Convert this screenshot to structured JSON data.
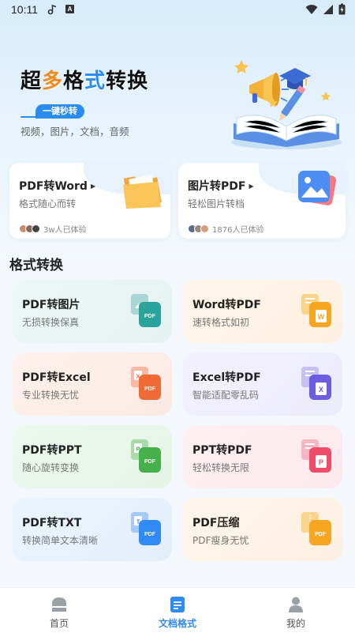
{
  "status_bar": {
    "time": "10:11",
    "notif_letter": "A"
  },
  "hero": {
    "title_pre": "超",
    "title_accent": "多",
    "title_mid": "格",
    "title_accent2": "式",
    "title_post": "转换",
    "tag": "一键秒转",
    "subtitle": "视频，图片，文档，音频"
  },
  "features": [
    {
      "title": "PDF转Word",
      "subtitle": "格式随心而转",
      "users": "3w人已体验"
    },
    {
      "title": "图片转PDF",
      "subtitle": "轻松图片转档",
      "users": "1876人已体验"
    }
  ],
  "section_title": "格式转换",
  "cards": [
    {
      "title": "PDF转图片",
      "subtitle": "无损转换保真"
    },
    {
      "title": "Word转PDF",
      "subtitle": "速转格式如初"
    },
    {
      "title": "PDF转Excel",
      "subtitle": "专业转换无忧"
    },
    {
      "title": "Excel转PDF",
      "subtitle": "智能适配零乱码"
    },
    {
      "title": "PDF转PPT",
      "subtitle": "随心旋转变换"
    },
    {
      "title": "PPT转PDF",
      "subtitle": "轻松转换无限"
    },
    {
      "title": "PDF转TXT",
      "subtitle": "转换简单文本清晰"
    },
    {
      "title": "PDF压缩",
      "subtitle": "PDF瘦身无忧"
    }
  ],
  "icon_badges": {
    "pdf": "PDF",
    "txt": "T",
    "word": "W",
    "excel": "X",
    "ppt": "P"
  },
  "nav": [
    {
      "label": "首页",
      "icon": "home-icon"
    },
    {
      "label": "文档格式",
      "icon": "document-icon"
    },
    {
      "label": "我的",
      "icon": "profile-icon"
    }
  ],
  "colors": {
    "accent_blue": "#2f8af5",
    "title_orange": "#f28a1b"
  }
}
